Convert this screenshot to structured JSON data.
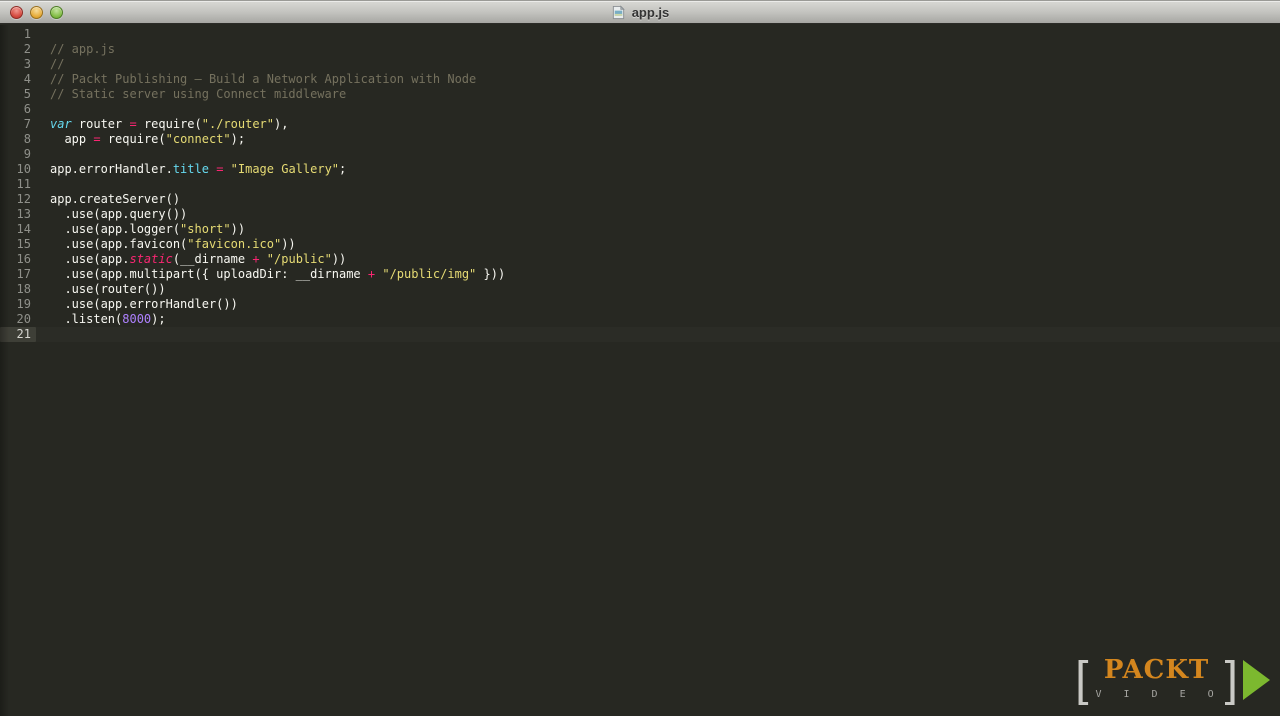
{
  "window": {
    "title": "app.js",
    "icon": "document-icon"
  },
  "titlebar": {
    "buttons": [
      "close",
      "minimize",
      "zoom"
    ]
  },
  "editor": {
    "language": "javascript",
    "current_line": 21,
    "lines": [
      {
        "num": 1,
        "segments": []
      },
      {
        "num": 2,
        "segments": [
          {
            "text": "// app.js",
            "style": "comment"
          }
        ]
      },
      {
        "num": 3,
        "segments": [
          {
            "text": "//",
            "style": "comment"
          }
        ]
      },
      {
        "num": 4,
        "segments": [
          {
            "text": "// Packt Publishing – Build a Network Application with Node",
            "style": "comment"
          }
        ]
      },
      {
        "num": 5,
        "segments": [
          {
            "text": "// Static server using Connect middleware",
            "style": "comment"
          }
        ]
      },
      {
        "num": 6,
        "segments": []
      },
      {
        "num": 7,
        "segments": [
          {
            "text": "var",
            "style": "keyword"
          },
          {
            "text": " router ",
            "style": "plain"
          },
          {
            "text": "=",
            "style": "operator"
          },
          {
            "text": " require(",
            "style": "plain"
          },
          {
            "text": "\"./router\"",
            "style": "string"
          },
          {
            "text": "),",
            "style": "plain"
          }
        ]
      },
      {
        "num": 8,
        "segments": [
          {
            "text": "  app ",
            "style": "plain"
          },
          {
            "text": "=",
            "style": "operator"
          },
          {
            "text": " require(",
            "style": "plain"
          },
          {
            "text": "\"connect\"",
            "style": "string"
          },
          {
            "text": ");",
            "style": "plain"
          }
        ]
      },
      {
        "num": 9,
        "segments": []
      },
      {
        "num": 10,
        "segments": [
          {
            "text": "app.errorHandler.",
            "style": "plain"
          },
          {
            "text": "title",
            "style": "property"
          },
          {
            "text": " ",
            "style": "plain"
          },
          {
            "text": "=",
            "style": "operator"
          },
          {
            "text": " ",
            "style": "plain"
          },
          {
            "text": "\"Image Gallery\"",
            "style": "string"
          },
          {
            "text": ";",
            "style": "plain"
          }
        ]
      },
      {
        "num": 11,
        "segments": []
      },
      {
        "num": 12,
        "segments": [
          {
            "text": "app.createServer()",
            "style": "plain"
          }
        ]
      },
      {
        "num": 13,
        "segments": [
          {
            "text": "  .use(app.query())",
            "style": "plain"
          }
        ]
      },
      {
        "num": 14,
        "segments": [
          {
            "text": "  .use(app.logger(",
            "style": "plain"
          },
          {
            "text": "\"short\"",
            "style": "string"
          },
          {
            "text": "))",
            "style": "plain"
          }
        ]
      },
      {
        "num": 15,
        "segments": [
          {
            "text": "  .use(app.favicon(",
            "style": "plain"
          },
          {
            "text": "\"favicon.ico\"",
            "style": "string"
          },
          {
            "text": "))",
            "style": "plain"
          }
        ]
      },
      {
        "num": 16,
        "segments": [
          {
            "text": "  .use(app.",
            "style": "plain"
          },
          {
            "text": "static",
            "style": "reserved"
          },
          {
            "text": "(__dirname ",
            "style": "plain"
          },
          {
            "text": "+",
            "style": "operator"
          },
          {
            "text": " ",
            "style": "plain"
          },
          {
            "text": "\"/public\"",
            "style": "string"
          },
          {
            "text": "))",
            "style": "plain"
          }
        ]
      },
      {
        "num": 17,
        "segments": [
          {
            "text": "  .use(app.multipart({ uploadDir: __dirname ",
            "style": "plain"
          },
          {
            "text": "+",
            "style": "operator"
          },
          {
            "text": " ",
            "style": "plain"
          },
          {
            "text": "\"/public/img\"",
            "style": "string"
          },
          {
            "text": " }))",
            "style": "plain"
          }
        ]
      },
      {
        "num": 18,
        "segments": [
          {
            "text": "  .use(router())",
            "style": "plain"
          }
        ]
      },
      {
        "num": 19,
        "segments": [
          {
            "text": "  .use(app.errorHandler())",
            "style": "plain"
          }
        ]
      },
      {
        "num": 20,
        "segments": [
          {
            "text": "  .listen(",
            "style": "plain"
          },
          {
            "text": "8000",
            "style": "number"
          },
          {
            "text": ");",
            "style": "plain"
          }
        ]
      },
      {
        "num": 21,
        "segments": []
      }
    ]
  },
  "logo": {
    "bracket_left": "[",
    "brand": "PACKT",
    "bracket_right": "]",
    "sub": "V I D E O"
  },
  "palette": {
    "editor_background": "#272822",
    "gutter_text": "#8f908a",
    "comment": "#75715e",
    "keyword": "#66d9ef",
    "reserved_word": "#f92672",
    "operator": "#f92672",
    "string": "#e6db74",
    "number": "#ae81ff",
    "plain_text": "#f8f8f2",
    "logo_orange": "#d4861e",
    "logo_green": "#7cb82f"
  }
}
